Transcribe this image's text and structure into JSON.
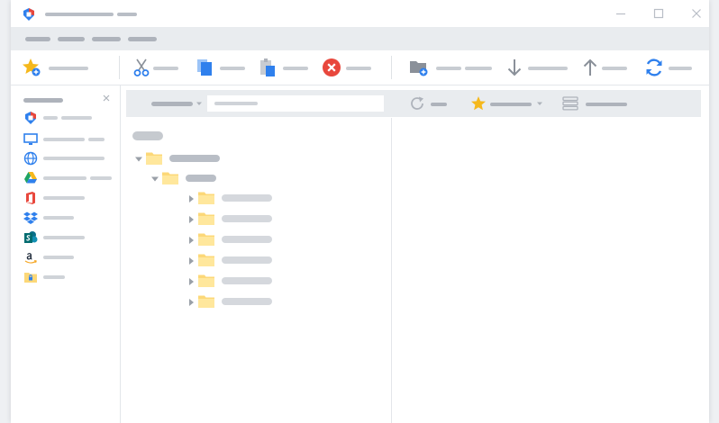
{
  "window": {
    "title": "",
    "controls": [
      "minimize-icon",
      "maximize-icon",
      "close-icon"
    ]
  },
  "menu": {
    "items": [
      "",
      "",
      "",
      ""
    ]
  },
  "toolbar": {
    "buttons": [
      {
        "icon": "favorite-add-icon",
        "label": ""
      },
      {
        "icon": "cut-icon",
        "label": ""
      },
      {
        "icon": "copy-icon",
        "label": ""
      },
      {
        "icon": "paste-icon",
        "label": ""
      },
      {
        "icon": "delete-icon",
        "label": ""
      },
      {
        "icon": "new-folder-icon",
        "label": ""
      },
      {
        "icon": "download-icon",
        "label": ""
      },
      {
        "icon": "upload-icon",
        "label": ""
      },
      {
        "icon": "sync-icon",
        "label": ""
      }
    ]
  },
  "sidebar": {
    "title": "",
    "items": [
      {
        "icon": "app-icon",
        "label": ""
      },
      {
        "icon": "computer-icon",
        "label": ""
      },
      {
        "icon": "globe-icon",
        "label": ""
      },
      {
        "icon": "google-drive-icon",
        "label": ""
      },
      {
        "icon": "office-icon",
        "label": ""
      },
      {
        "icon": "dropbox-icon",
        "label": ""
      },
      {
        "icon": "sharepoint-icon",
        "label": ""
      },
      {
        "icon": "amazon-icon",
        "label": ""
      },
      {
        "icon": "locked-folder-icon",
        "label": ""
      }
    ]
  },
  "pathbar": {
    "location": "",
    "path": ""
  },
  "subtoolbar": {
    "refresh_label": "",
    "favorites_label": "",
    "view_label": ""
  },
  "tree": {
    "root": "",
    "level1": [
      {
        "label": "",
        "expanded": true
      }
    ],
    "level2": [
      {
        "label": "",
        "expanded": true
      }
    ],
    "level3": [
      {
        "label": "",
        "expanded": false
      },
      {
        "label": "",
        "expanded": false
      },
      {
        "label": "",
        "expanded": false
      },
      {
        "label": "",
        "expanded": false
      },
      {
        "label": "",
        "expanded": false
      },
      {
        "label": "",
        "expanded": false
      }
    ]
  },
  "colors": {
    "folder": "#fcd878",
    "accent_blue": "#2f80ed",
    "delete_red": "#e8473c",
    "star": "#f5b81c",
    "placeholder": "#cfd3d8"
  }
}
